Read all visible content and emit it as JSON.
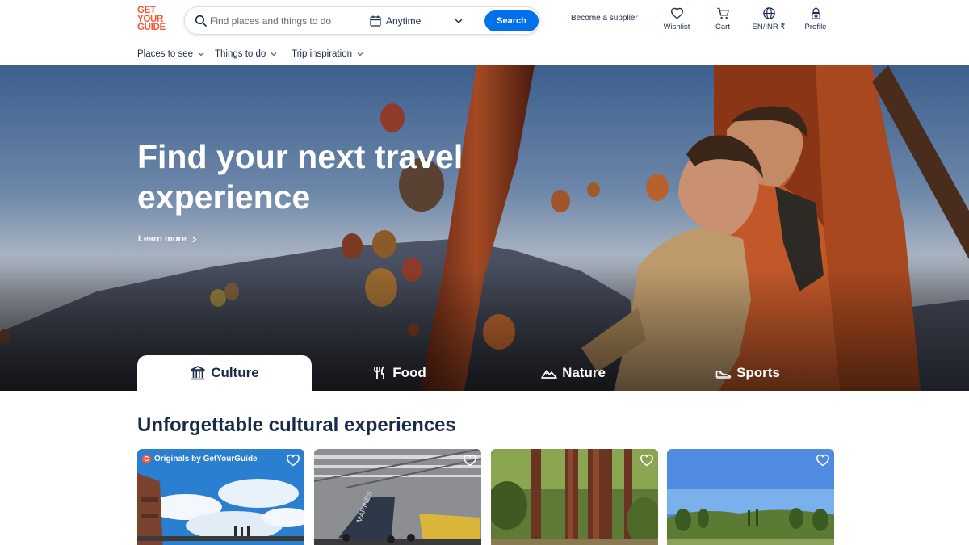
{
  "logo": {
    "lines": [
      "GET",
      "YOUR",
      "GUIDE"
    ]
  },
  "search": {
    "placeholder": "Find places and things to do",
    "date_label": "Anytime",
    "button_label": "Search"
  },
  "header": {
    "supplier_link": "Become a supplier",
    "actions": [
      {
        "label": "Wishlist",
        "icon": "heart-icon"
      },
      {
        "label": "Cart",
        "icon": "cart-icon"
      },
      {
        "label": "EN/INR ₹",
        "icon": "globe-icon"
      },
      {
        "label": "Profile",
        "icon": "profile-icon"
      }
    ]
  },
  "subnav": {
    "items": [
      "Places to see",
      "Things to do",
      "Trip inspiration"
    ]
  },
  "hero": {
    "title_lines": [
      "Find your next travel",
      "experience"
    ],
    "learn_more": "Learn more"
  },
  "tabs": [
    {
      "label": "Culture",
      "icon": "museum-icon",
      "active": true
    },
    {
      "label": "Food",
      "icon": "fork-knife-icon",
      "active": false
    },
    {
      "label": "Nature",
      "icon": "mountain-icon",
      "active": false
    },
    {
      "label": "Sports",
      "icon": "sneaker-icon",
      "active": false
    }
  ],
  "section": {
    "title": "Unforgettable cultural experiences",
    "cards": [
      {
        "badge": "Originals by GetYourGuide",
        "image": "skyline-observation-deck"
      },
      {
        "badge": "",
        "image": "aircraft-carrier-museum"
      },
      {
        "badge": "",
        "image": "redwood-forest"
      },
      {
        "badge": "",
        "image": "vineyard-landscape"
      }
    ]
  },
  "colors": {
    "brand": "#ff5533",
    "primary": "#0071eb",
    "text": "#1a2b49"
  }
}
